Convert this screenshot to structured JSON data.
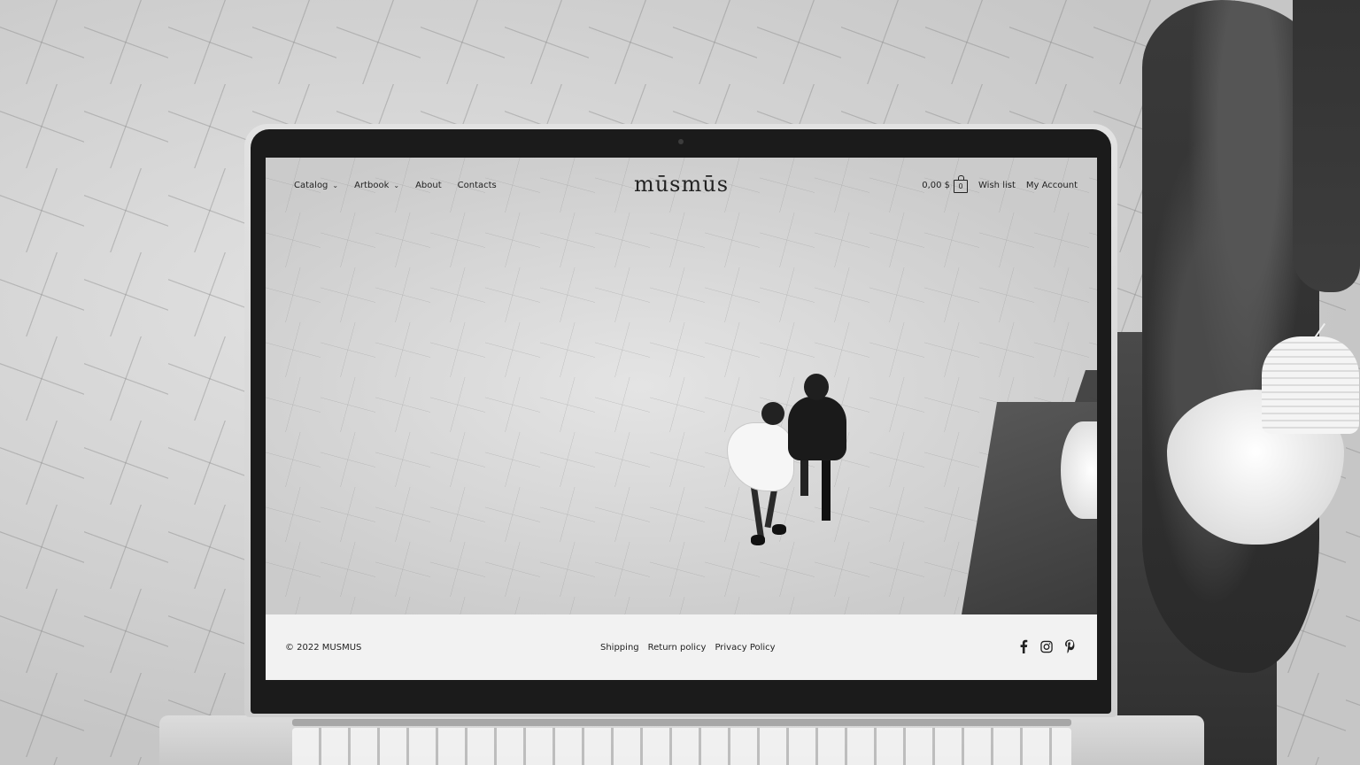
{
  "header": {
    "logo": "mūsmūs",
    "nav": [
      {
        "label": "Catalog",
        "dropdown": true
      },
      {
        "label": "Artbook",
        "dropdown": true
      },
      {
        "label": "About",
        "dropdown": false
      },
      {
        "label": "Contacts",
        "dropdown": false
      }
    ],
    "cart_total": "0,00 $",
    "cart_count": "0",
    "wishlist_label": "Wish list",
    "account_label": "My Account"
  },
  "footer": {
    "copyright": "© 2022 MUSMUS",
    "links": [
      "Shipping",
      "Return policy",
      "Privacy Policy"
    ],
    "socials": [
      "facebook-icon",
      "instagram-icon",
      "pinterest-icon"
    ]
  },
  "icons": {
    "dropdown": "chevron-down-icon",
    "cart": "shopping-bag-icon"
  }
}
